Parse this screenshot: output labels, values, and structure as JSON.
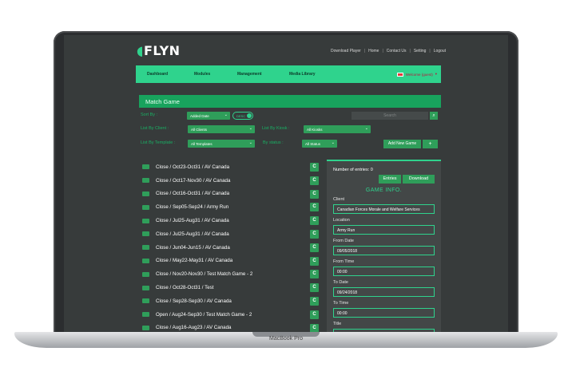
{
  "device": {
    "label": "MacBook Pro"
  },
  "header": {
    "logo": "FLYN",
    "links": [
      "Download Player",
      "Home",
      "Contact Us",
      "Setting",
      "Logout"
    ]
  },
  "nav": {
    "items": [
      "Dashboard",
      "Modules",
      "Management",
      "Media Library"
    ],
    "user": "Welcome (guest)"
  },
  "panel": {
    "title": "Match Game",
    "filters": {
      "sort_by_label": "Sort By :",
      "sort_by_value": "Added Date",
      "order_toggle": "DESC",
      "search_placeholder": "Search",
      "list_clients_label": "List By Client :",
      "list_clients_value": "All Clients",
      "list_kiosks_label": "List By Kiosk :",
      "list_kiosks_value": "All Kiosks",
      "list_templates_label": "List By Template :",
      "list_templates_value": "All Templates",
      "status_label": "By status :",
      "status_value": "All Status",
      "add_new_label": "Add New Game",
      "add_plus": "+"
    }
  },
  "games": [
    "Close / Oct23-Oct31 / AV Canada",
    "Close / Oct17-Nov30 / AV Canada",
    "Close / Oct16-Oct31 / AV Canada",
    "Close / Sep05-Sep24 / Army Run",
    "Close / Jul25-Aug31 / AV Canada",
    "Close / Jul25-Aug31 / AV Canada",
    "Close / Jun04-Jun15 / AV Canada",
    "Close / May22-May31 / AV Canada",
    "Close / Nov20-Nov30 / Test Match Game - 2",
    "Close / Oct28-Oct31 / Test",
    "Close / Sep28-Sep30 / AV Canada",
    "Open / Aug24-Sep30 / Test Match Game - 2",
    "Close / Aug16-Aug23 / AV Canada"
  ],
  "game_action": "C",
  "info": {
    "entries_count": "Number of entries: 0",
    "entries_button": "Entries",
    "download_button": "Download",
    "heading": "GAME INFO.",
    "client_label": "Client",
    "client_value": "Canadian Forces Morale and Welfare Services",
    "location_label": "Location",
    "location_value": "Army Run",
    "from_date_label": "From Date",
    "from_date_value": "09/05/2018",
    "from_time_label": "From Time",
    "from_time_value": "00:00",
    "to_date_label": "To Date",
    "to_date_value": "09/24/2018",
    "to_time_label": "To Time",
    "to_time_value": "00:00",
    "title_label": "Title"
  }
}
